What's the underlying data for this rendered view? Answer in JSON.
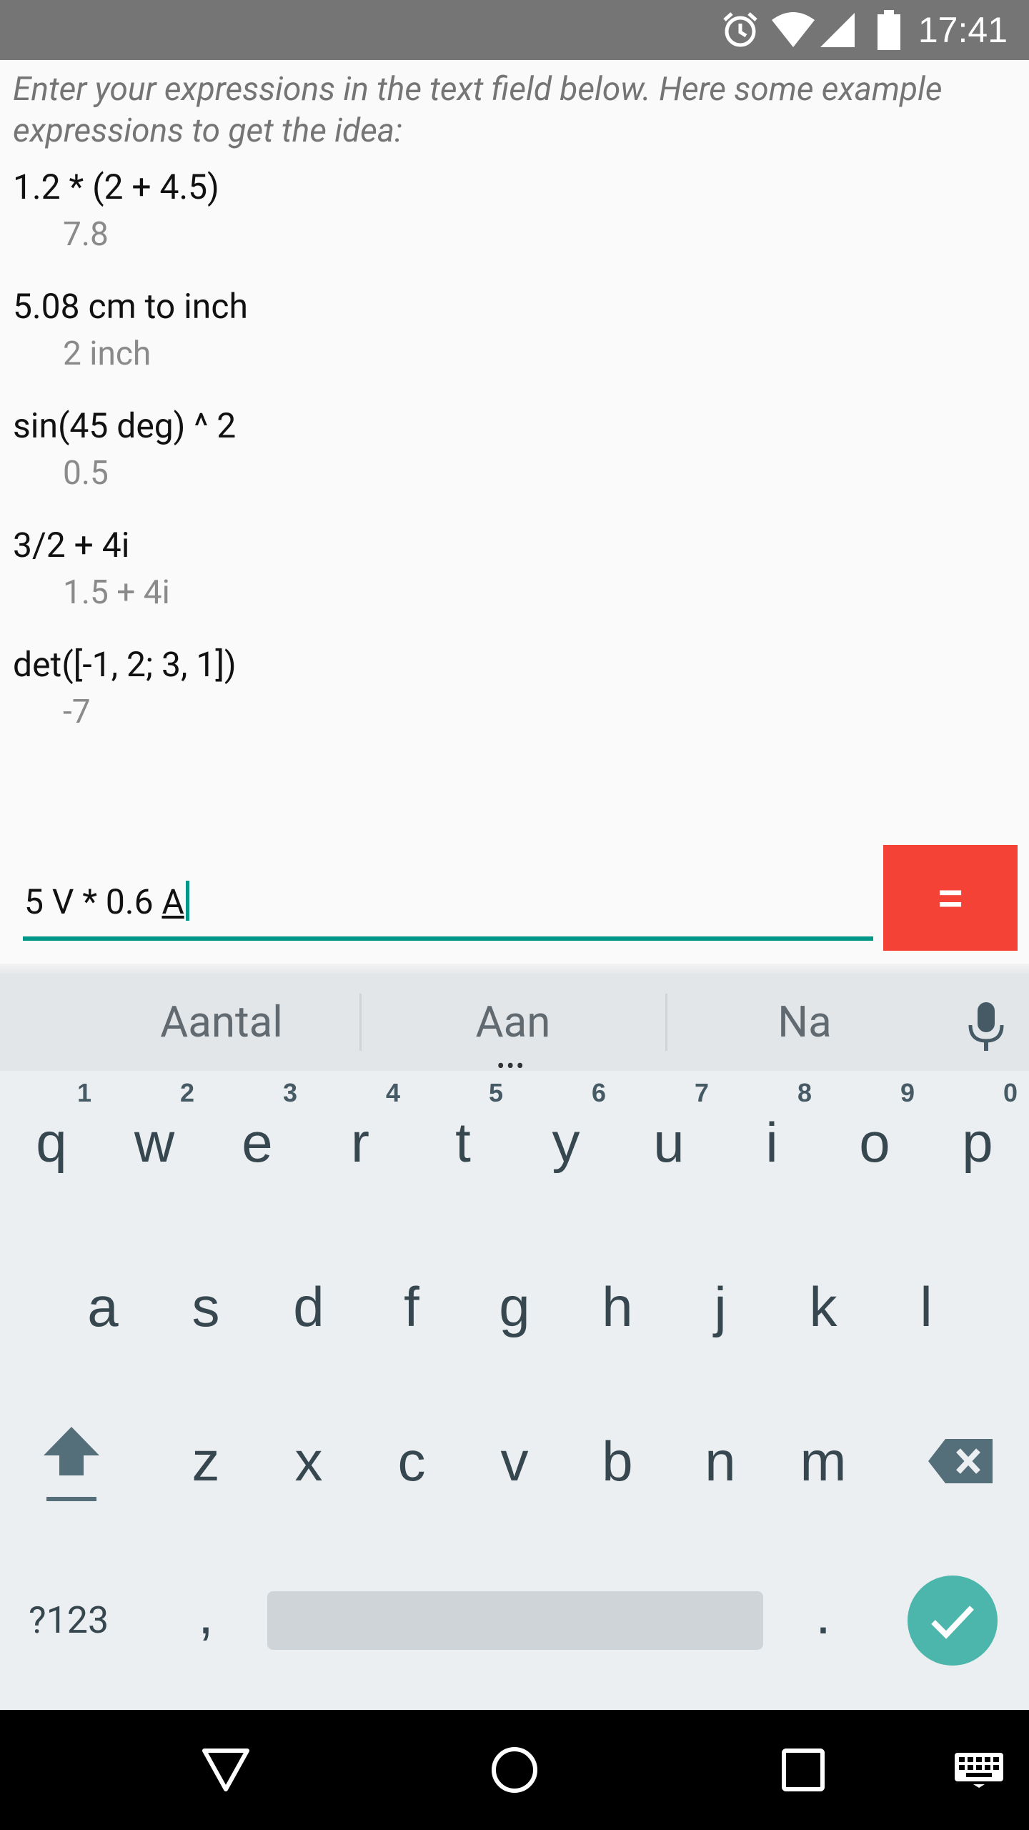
{
  "status_bar": {
    "time": "17:41",
    "icons": [
      "alarm-icon",
      "wifi-icon",
      "signal-icon",
      "battery-icon"
    ]
  },
  "intro_text": "Enter your expressions in the text field below. Here some example expressions to get the idea:",
  "examples": [
    {
      "expression": "1.2 * (2 + 4.5)",
      "result": "7.8"
    },
    {
      "expression": "5.08 cm to inch",
      "result": "2 inch"
    },
    {
      "expression": "sin(45 deg) ^ 2",
      "result": "0.5"
    },
    {
      "expression": "3/2 + 4i",
      "result": "1.5 + 4i"
    },
    {
      "expression": "det([-1, 2; 3, 1])",
      "result": "-7"
    }
  ],
  "input": {
    "value_prefix": "5 V * 0.6 ",
    "value_composing": "A",
    "equals_label": "="
  },
  "keyboard": {
    "suggestions": [
      "Aantal",
      "Aan",
      "Na"
    ],
    "row1": [
      {
        "key": "q",
        "hint": "1"
      },
      {
        "key": "w",
        "hint": "2"
      },
      {
        "key": "e",
        "hint": "3"
      },
      {
        "key": "r",
        "hint": "4"
      },
      {
        "key": "t",
        "hint": "5"
      },
      {
        "key": "y",
        "hint": "6"
      },
      {
        "key": "u",
        "hint": "7"
      },
      {
        "key": "i",
        "hint": "8"
      },
      {
        "key": "o",
        "hint": "9"
      },
      {
        "key": "p",
        "hint": "0"
      }
    ],
    "row2": [
      "a",
      "s",
      "d",
      "f",
      "g",
      "h",
      "j",
      "k",
      "l"
    ],
    "row3": [
      "z",
      "x",
      "c",
      "v",
      "b",
      "n",
      "m"
    ],
    "symbols_label": "?123",
    "comma": ",",
    "period": "."
  },
  "colors": {
    "accent": "#009688",
    "equals_button": "#f44336",
    "done_button": "#4db6ac",
    "status_bar": "#757575"
  }
}
